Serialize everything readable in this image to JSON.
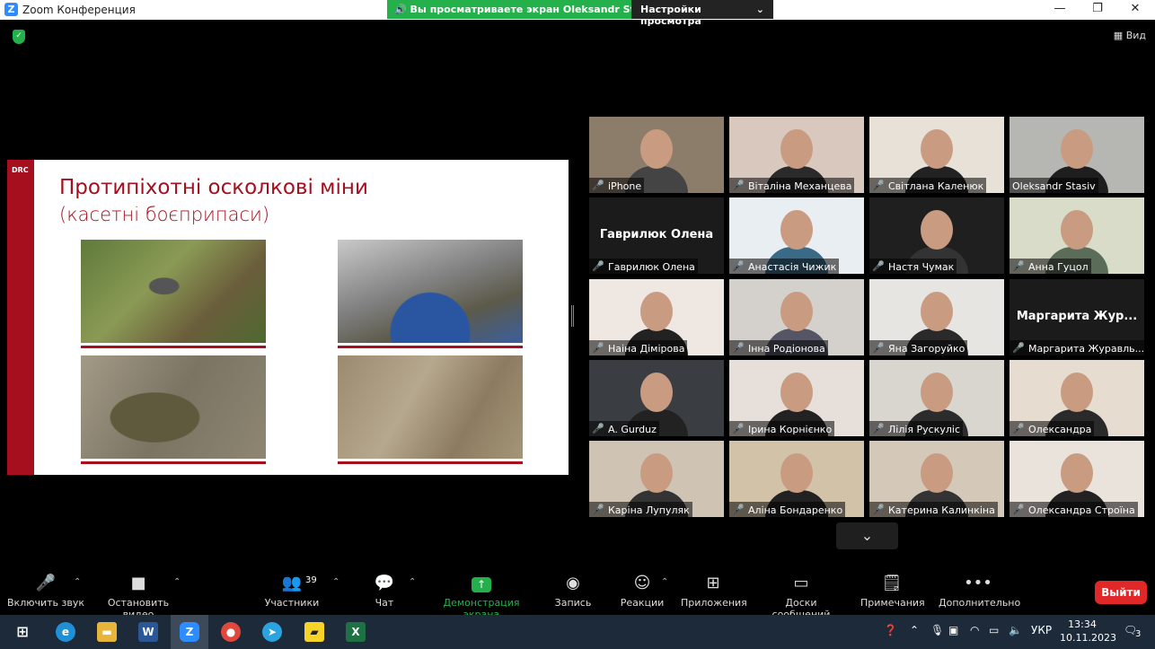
{
  "window": {
    "title": "Zoom Конференция",
    "share_banner": "Вы просматриваете экран Oleksandr Stasiv",
    "view_settings": "Настройки просмотра",
    "view_button": "Вид"
  },
  "slide": {
    "logo": "DRC",
    "title": "Протипіхотні осколкові міни",
    "subtitle": "(касетні боєприпаси)"
  },
  "participants": [
    {
      "name": "iPhone",
      "muted": true
    },
    {
      "name": "Віталіна Механцева",
      "muted": true
    },
    {
      "name": "Світлана Каленюк",
      "muted": true
    },
    {
      "name": "Oleksandr Stasiv",
      "muted": false,
      "active": true
    },
    {
      "name": "Гаврилюк Олена",
      "muted": true,
      "display": "Гаврилюк Олена"
    },
    {
      "name": "Анастасія Чижик",
      "muted": true
    },
    {
      "name": "Настя Чумак",
      "muted": true
    },
    {
      "name": "Анна Гуцол",
      "muted": true
    },
    {
      "name": "Наіна Дімірова",
      "muted": true
    },
    {
      "name": "Інна Родіонова",
      "muted": true
    },
    {
      "name": "Яна Загоруйко",
      "muted": true
    },
    {
      "name": "Маргарита Журавль...",
      "muted": true,
      "display": "Маргарита  Жур..."
    },
    {
      "name": "A. Gurduz",
      "muted": true
    },
    {
      "name": "Ірина Корнієнко",
      "muted": true
    },
    {
      "name": "Лілія Рускуліс",
      "muted": true
    },
    {
      "name": "Олександра",
      "muted": true
    },
    {
      "name": "Каріна Лупуляк",
      "muted": true
    },
    {
      "name": "Аліна Бондаренко",
      "muted": true
    },
    {
      "name": "Катерина Калинкіна",
      "muted": true
    },
    {
      "name": "Олександра Строїна",
      "muted": true
    }
  ],
  "toolbar": {
    "mute": "Включить звук",
    "video": "Остановить видео",
    "participants": "Участники",
    "participants_count": "39",
    "chat": "Чат",
    "share": "Демонстрация экрана",
    "record": "Запись",
    "reactions": "Реакции",
    "apps": "Приложения",
    "whiteboards": "Доски сообщений",
    "notes": "Примечания",
    "more": "Дополнительно",
    "leave": "Выйти"
  },
  "taskbar": {
    "language": "УКР",
    "time": "13:34",
    "date": "10.11.2023",
    "notifications": "3"
  },
  "colors": {
    "accent_red": "#a50f1e",
    "zoom_green": "#24b14b",
    "leave_red": "#e02828",
    "active_speaker": "#d8dd5b"
  }
}
